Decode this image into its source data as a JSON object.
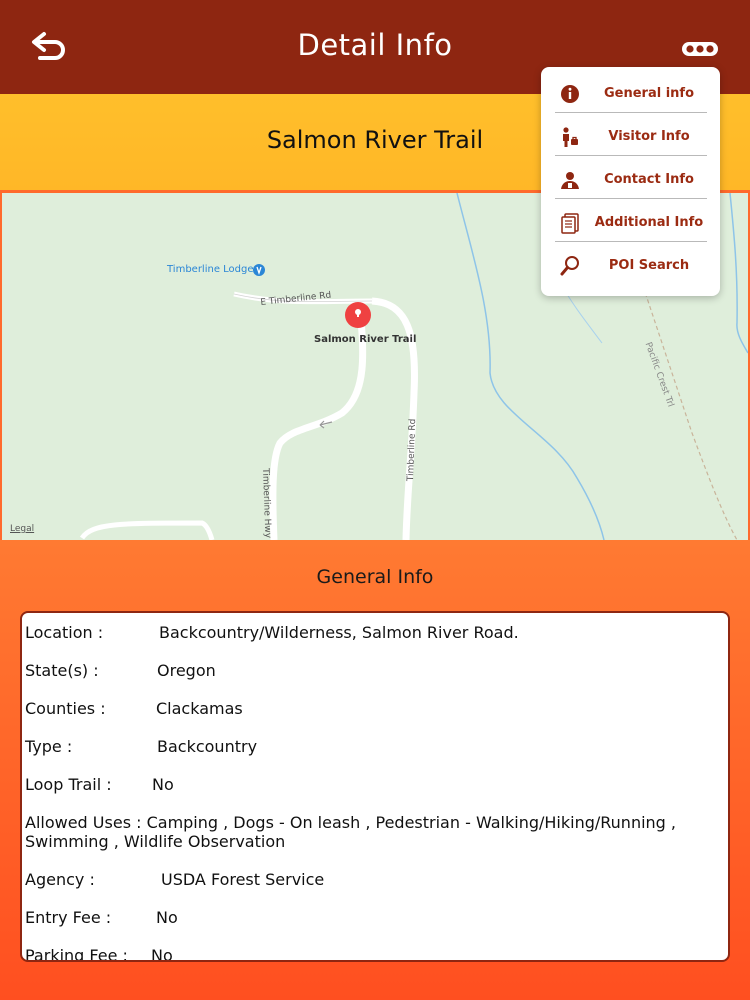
{
  "header": {
    "title": "Detail Info"
  },
  "trail": {
    "name": "Salmon River Trail"
  },
  "map": {
    "poi_label": "Timberline Lodge",
    "marker_label": "Salmon River Trail",
    "roads": {
      "e_timberline": "E Timberline Rd",
      "timberline_rd": "Timberline Rd",
      "timberline_hwy": "Timberline Hwy",
      "pacific_crest": "Pacific Crest Trl"
    },
    "legal": "Legal"
  },
  "menu": {
    "items": [
      {
        "label": "General info",
        "icon": "info-icon"
      },
      {
        "label": "Visitor Info",
        "icon": "visitor-icon"
      },
      {
        "label": "Contact Info",
        "icon": "contact-icon"
      },
      {
        "label": "Additional Info",
        "icon": "document-icon"
      },
      {
        "label": "POI Search",
        "icon": "search-icon"
      }
    ]
  },
  "general_info": {
    "heading": "General Info",
    "location_label": "Location :",
    "location_value": "Backcountry/Wilderness, Salmon River Road.",
    "state_label": "State(s) :",
    "state_value": "Oregon",
    "counties_label": "Counties :",
    "counties_value": "Clackamas",
    "type_label": "Type :",
    "type_value": "Backcountry",
    "loop_label": "Loop Trail :",
    "loop_value": "No",
    "uses_text": "Allowed Uses : Camping  , Dogs - On leash , Pedestrian - Walking/Hiking/Running , Swimming , Wildlife Observation",
    "agency_label": "Agency :",
    "agency_value": "USDA Forest Service",
    "entry_label": "Entry Fee :",
    "entry_value": "No",
    "parking_label": "Parking Fee :",
    "parking_value": "No"
  },
  "colors": {
    "header": "#8e2611",
    "title_bar": "#ffbb29",
    "section": "#ff6a2c",
    "menu_text": "#9b2b12"
  }
}
